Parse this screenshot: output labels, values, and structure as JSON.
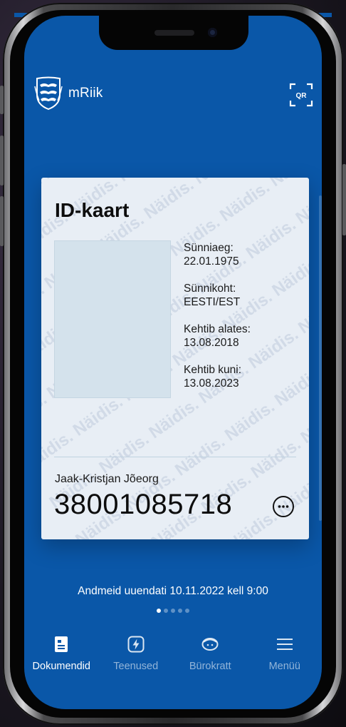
{
  "app": {
    "name": "mRiik",
    "qr_label": "QR"
  },
  "card": {
    "title": "ID-kaart",
    "watermark_word": "Näidis.",
    "fields": [
      {
        "label": "Sünniaeg:",
        "value": "22.01.1975"
      },
      {
        "label": "Sünnikoht:",
        "value": "EESTI/EST"
      },
      {
        "label": "Kehtib alates:",
        "value": "13.08.2018"
      },
      {
        "label": "Kehtib kuni:",
        "value": "13.08.2023"
      }
    ],
    "holder_name": "Jaak-Kristjan Jõeorg",
    "id_code": "38001085718"
  },
  "sync_text": "Andmeid uuendati 10.11.2022 kell 9:00",
  "pager": {
    "count": 5,
    "active_index": 0
  },
  "nav": {
    "items": [
      {
        "label": "Dokumendid",
        "icon": "document-icon",
        "active": true
      },
      {
        "label": "Teenused",
        "icon": "lightning-icon",
        "active": false
      },
      {
        "label": "Bürokratt",
        "icon": "burokratt-icon",
        "active": false
      },
      {
        "label": "Menüü",
        "icon": "menu-icon",
        "active": false
      }
    ]
  },
  "colors": {
    "brand_blue": "#0a57a8",
    "card_bg": "#e8eef5"
  }
}
